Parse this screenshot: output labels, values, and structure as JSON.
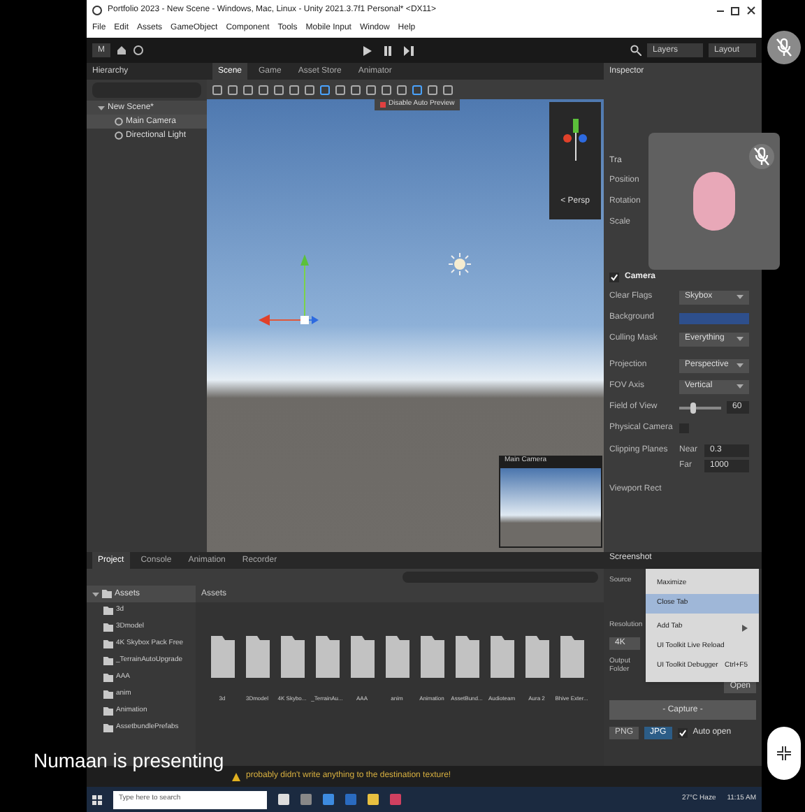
{
  "window": {
    "title": "Portfolio 2023 - New Scene - Windows, Mac, Linux - Unity 2021.3.7f1 Personal* <DX11>"
  },
  "menu": [
    "File",
    "Edit",
    "Assets",
    "GameObject",
    "Component",
    "Tools",
    "Mobile Input",
    "Window",
    "Help"
  ],
  "toolbar": {
    "account": "M",
    "layers": "Layers",
    "layout": "Layout"
  },
  "hierarchy": {
    "title": "Hierarchy",
    "items": [
      {
        "label": "New Scene*",
        "expanded": true,
        "children": [
          {
            "label": "Main Camera",
            "selected": true
          },
          {
            "label": "Directional Light",
            "selected": false
          }
        ]
      }
    ]
  },
  "scene": {
    "tabs": [
      {
        "label": "Scene",
        "selected": true
      },
      {
        "label": "Game",
        "selected": false
      },
      {
        "label": "Asset Store",
        "selected": false
      },
      {
        "label": "Animator",
        "selected": false
      }
    ],
    "badge": "Disable Auto Preview",
    "gizmo_label": "< Persp",
    "camera_preview": "Main Camera"
  },
  "inspector": {
    "tab": "Inspector",
    "transform": {
      "title": "Tra",
      "fields": [
        "Position",
        "Rotation",
        "Scale"
      ]
    },
    "camera": {
      "title": "Camera",
      "enabled": true,
      "clear_flags": {
        "label": "Clear Flags",
        "value": "Skybox"
      },
      "background": {
        "label": "Background",
        "color": "#2e4f8c"
      },
      "culling_mask": {
        "label": "Culling Mask",
        "value": "Everything"
      },
      "projection": {
        "label": "Projection",
        "value": "Perspective"
      },
      "fov_axis": {
        "label": "FOV Axis",
        "value": "Vertical"
      },
      "field_of_view": {
        "label": "Field of View",
        "level": 0.3,
        "value": "60"
      },
      "physical_camera": {
        "label": "Physical Camera",
        "checked": false
      },
      "clipping": {
        "label": "Clipping Planes",
        "near_label": "Near",
        "near": "0.3",
        "far_label": "Far",
        "far": "1000"
      },
      "viewport": "Viewport Rect"
    }
  },
  "project": {
    "tabs": [
      {
        "label": "Project",
        "selected": true
      },
      {
        "label": "Console",
        "selected": false
      },
      {
        "label": "Animation",
        "selected": false
      },
      {
        "label": "Recorder",
        "selected": false
      }
    ],
    "tree": [
      {
        "label": "Assets",
        "expanded": true,
        "selected": true,
        "children": [
          {
            "label": "3d",
            "selected": false
          },
          {
            "label": "3Dmodel",
            "selected": false
          },
          {
            "label": "4K Skybox Pack Free",
            "selected": false
          },
          {
            "label": "_TerrainAutoUpgrade",
            "selected": false
          },
          {
            "label": "AAA",
            "selected": false
          },
          {
            "label": "anim",
            "selected": false
          },
          {
            "label": "Animation",
            "selected": false
          },
          {
            "label": "AssetbundlePrefabs",
            "selected": false
          }
        ]
      }
    ],
    "breadcrumb": "Assets",
    "folders": [
      "3d",
      "3Dmodel",
      "4K Skybo...",
      "_TerrainAu...",
      "AAA",
      "anim",
      "Animation",
      "AssetBund...",
      "Audioteam",
      "Aura 2",
      "Bhive Exter..."
    ]
  },
  "screenshot": {
    "tab": "Screenshot",
    "source": "Source",
    "resolution": "Resolution",
    "resolution_value": "4K",
    "output_folder": "Output Folder",
    "open": "Open",
    "capture": "- Capture -",
    "formats": [
      {
        "label": "PNG",
        "selected": false
      },
      {
        "label": "JPG",
        "selected": true
      }
    ],
    "auto_open": {
      "label": "Auto open",
      "checked": true
    }
  },
  "context_menu": [
    {
      "label": "Maximize",
      "selected": false
    },
    {
      "label": "Close Tab",
      "selected": true
    },
    {
      "label": "Add Tab",
      "selected": false,
      "submenu": true
    },
    {
      "label": "UI Toolkit Live Reload",
      "selected": false
    },
    {
      "label": "UI Toolkit Debugger",
      "selected": false,
      "shortcut": "Ctrl+F5"
    }
  ],
  "status": "probably didn't write anything to the destination texture!",
  "taskbar": {
    "search_placeholder": "Type here to search",
    "weather": "27°C Haze",
    "time": "11:15 AM"
  },
  "meeting": {
    "presenter": "Numaan is presenting",
    "participant_muted": true,
    "self_muted": true
  }
}
